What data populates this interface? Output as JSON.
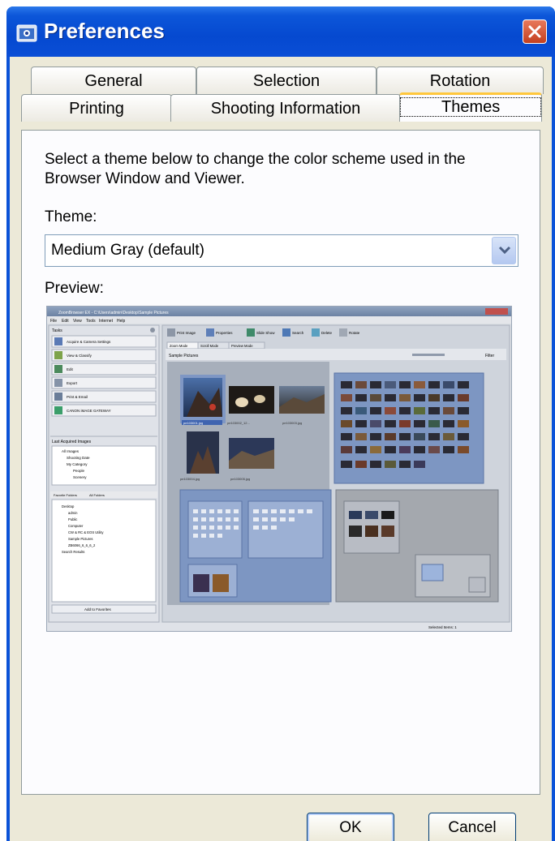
{
  "window": {
    "title": "Preferences"
  },
  "tabs": {
    "row_back": [
      {
        "label": "General"
      },
      {
        "label": "Selection"
      },
      {
        "label": "Rotation"
      }
    ],
    "row_front": [
      {
        "label": "Printing"
      },
      {
        "label": "Shooting Information"
      },
      {
        "label": "Themes",
        "active": true
      }
    ]
  },
  "themes_panel": {
    "description": "Select a theme below to change the color scheme used in the Browser Window and Viewer.",
    "theme_label": "Theme:",
    "theme_value": "Medium Gray (default)",
    "preview_label": "Preview:"
  },
  "preview": {
    "app_title": "ZoomBrowser EX - C:\\Users\\admin\\Desktop\\Sample Pictures",
    "menu": [
      "File",
      "Edit",
      "View",
      "Tools",
      "Internet",
      "Help"
    ],
    "tasks_header": "Tasks",
    "tasks": [
      "Acquire & Camera Settings",
      "View & Classify",
      "Edit",
      "Export",
      "Print & Email",
      "CANON iMAGE GATEWAY"
    ],
    "last_acquired_header": "Last Acquired Images",
    "last_acquired_items": [
      "All Images",
      "Shooting Date",
      "My Category",
      "People",
      "Scenery"
    ],
    "folder_tabs": [
      "Favorite Folders",
      "All Folders"
    ],
    "folders": [
      "Desktop",
      "admin",
      "Public",
      "Computer",
      "CW & RC & EOS Utility",
      "Sample Pictures",
      "ZB6066_6_6_6_2",
      "Search Results"
    ],
    "add_favorites": "Add to Favorites",
    "toolbar": [
      "Print Image",
      "Properties",
      "Slide Show",
      "Search",
      "Delete",
      "Rotate"
    ],
    "mode_tabs": [
      "Zoom Mode",
      "Scroll Mode",
      "Preview Mode"
    ],
    "folder_label": "Sample Pictures",
    "filter_label": "Filter",
    "thumbnails": [
      "pe103001.jpg",
      "pe103002_12...",
      "pe103003.jpg",
      "pe103004.jpg",
      "pe103005.jpg"
    ],
    "status": "Selected Items: 1"
  },
  "buttons": {
    "ok": "OK",
    "cancel": "Cancel"
  },
  "colors": {
    "title_bar": "#0549d0",
    "active_tab_accent": "#ffc73c",
    "close_button": "#d2502c"
  }
}
